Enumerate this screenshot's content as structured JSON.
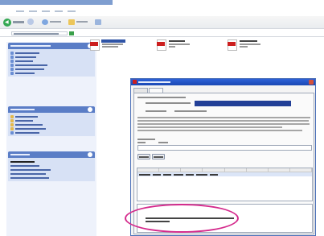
{
  "colors": {
    "accent": "#d42a8c",
    "pdf_red": "#cc1f1f",
    "dialog_title": "#2d62d8",
    "taskpane_head": "#5a7dc6"
  },
  "icons": [
    "back-icon",
    "forward-icon",
    "folder-icon",
    "search-icon",
    "pdf-file-icon",
    "close-icon"
  ]
}
